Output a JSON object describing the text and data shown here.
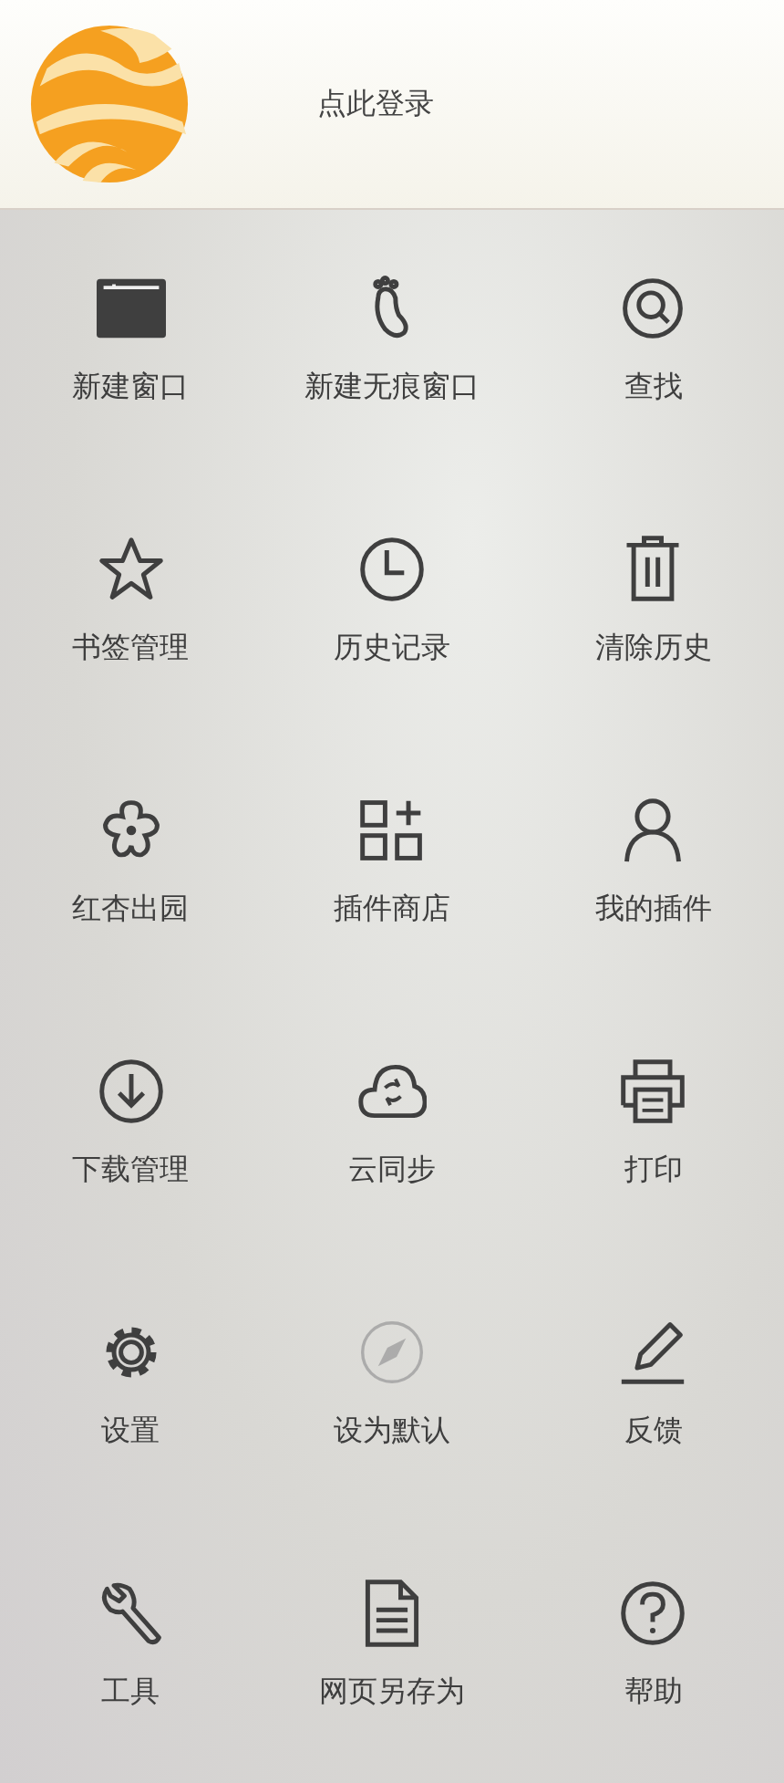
{
  "header": {
    "login_label": "点此登录"
  },
  "menu_items": [
    {
      "label": "新建窗口",
      "disabled": false
    },
    {
      "label": "新建无痕窗口",
      "disabled": false
    },
    {
      "label": "查找",
      "disabled": false
    },
    {
      "label": "书签管理",
      "disabled": false
    },
    {
      "label": "历史记录",
      "disabled": false
    },
    {
      "label": "清除历史",
      "disabled": false
    },
    {
      "label": "红杏出园",
      "disabled": false
    },
    {
      "label": "插件商店",
      "disabled": false
    },
    {
      "label": "我的插件",
      "disabled": false
    },
    {
      "label": "下载管理",
      "disabled": false
    },
    {
      "label": "云同步",
      "disabled": false
    },
    {
      "label": "打印",
      "disabled": false
    },
    {
      "label": "设置",
      "disabled": false
    },
    {
      "label": "设为默认",
      "disabled": true
    },
    {
      "label": "反馈",
      "disabled": false
    },
    {
      "label": "工具",
      "disabled": false
    },
    {
      "label": "网页另存为",
      "disabled": false
    },
    {
      "label": "帮助",
      "disabled": false
    }
  ]
}
